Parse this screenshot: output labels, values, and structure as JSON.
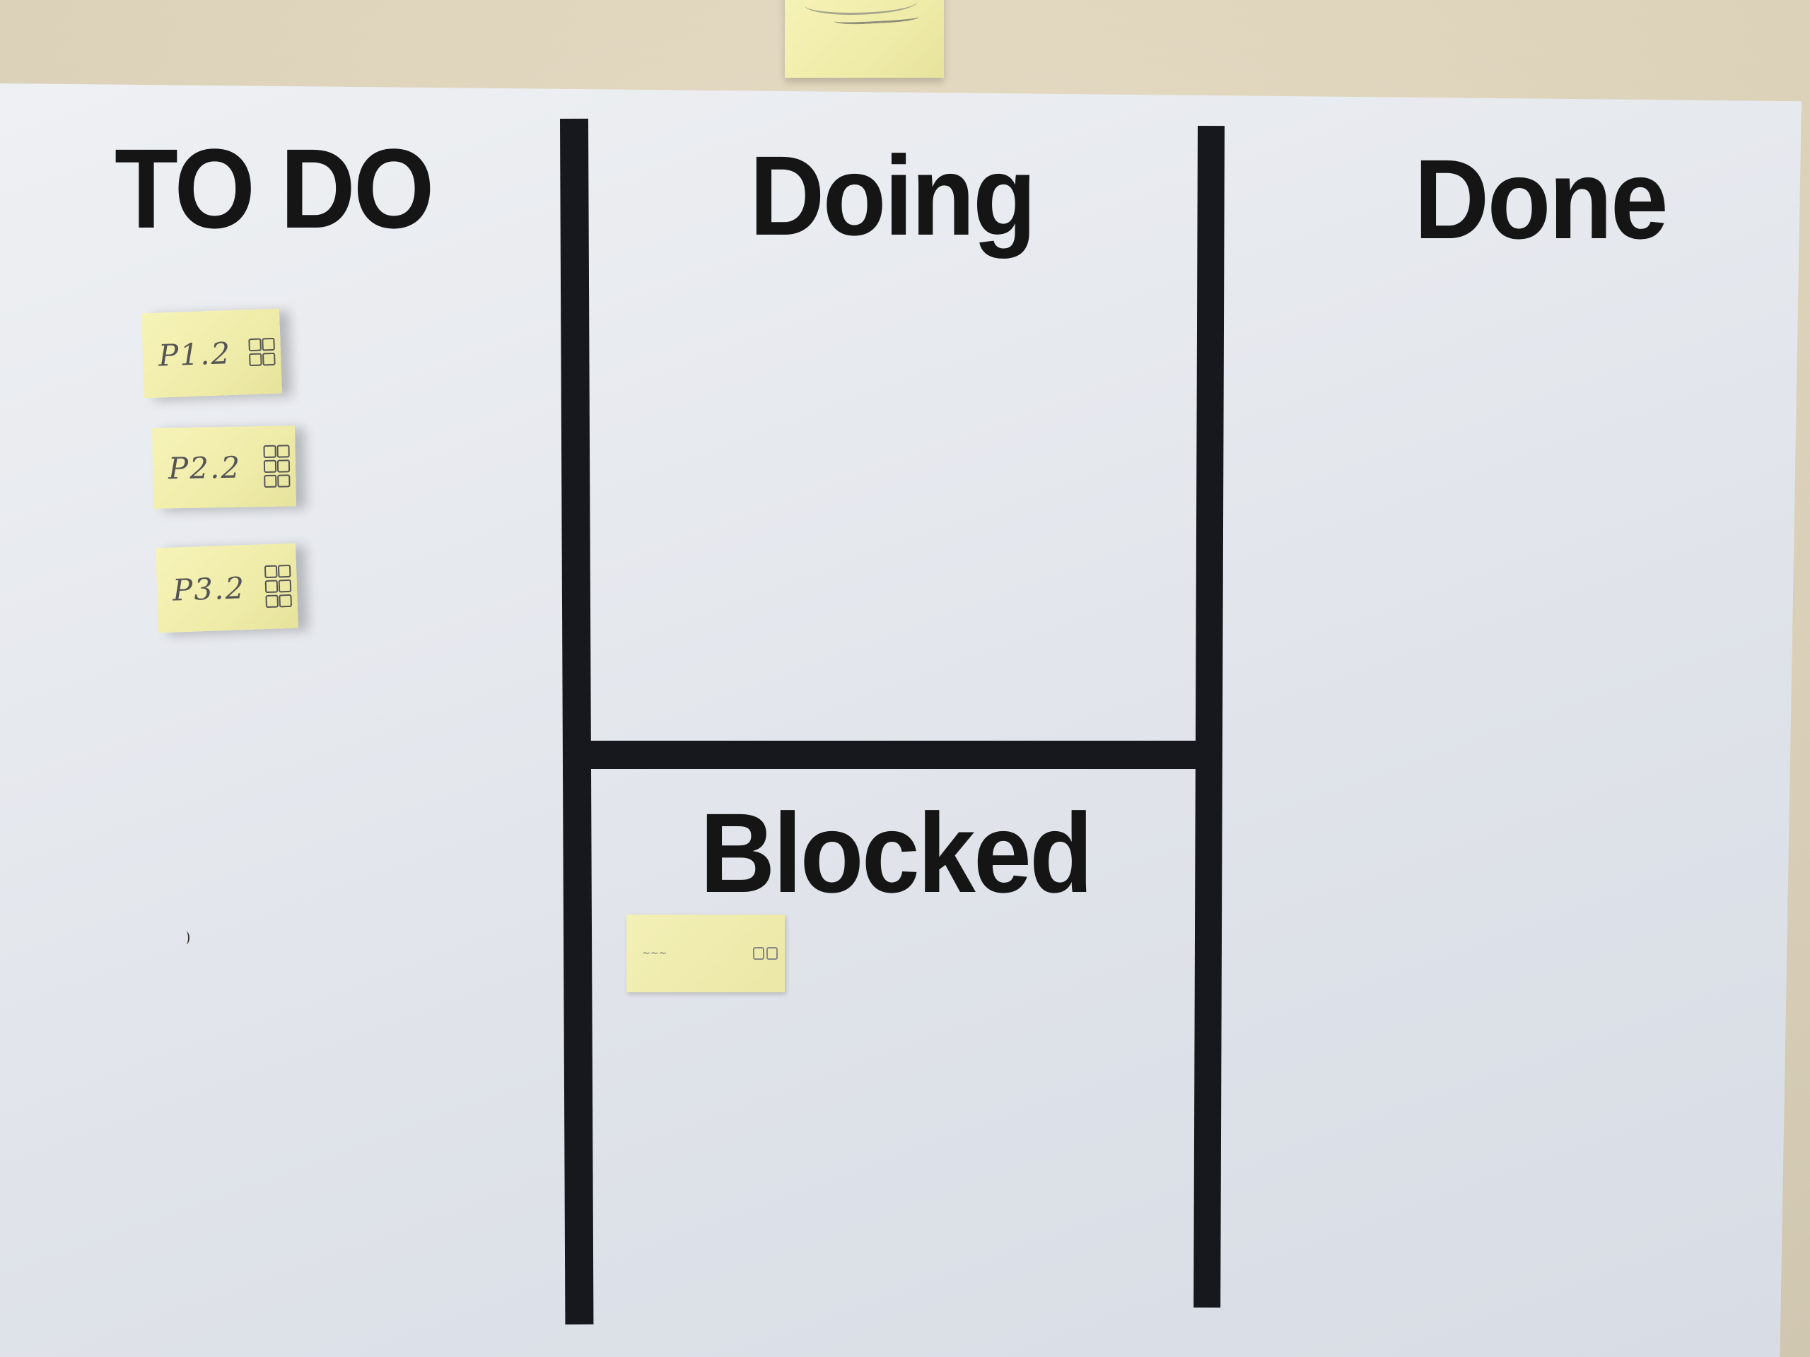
{
  "board": {
    "columns": {
      "todo": "TO DO",
      "doing": "Doing",
      "done": "Done",
      "blocked": "Blocked"
    },
    "cards": {
      "todo": [
        "P1.2",
        "P2.2",
        "P3.2"
      ]
    }
  }
}
